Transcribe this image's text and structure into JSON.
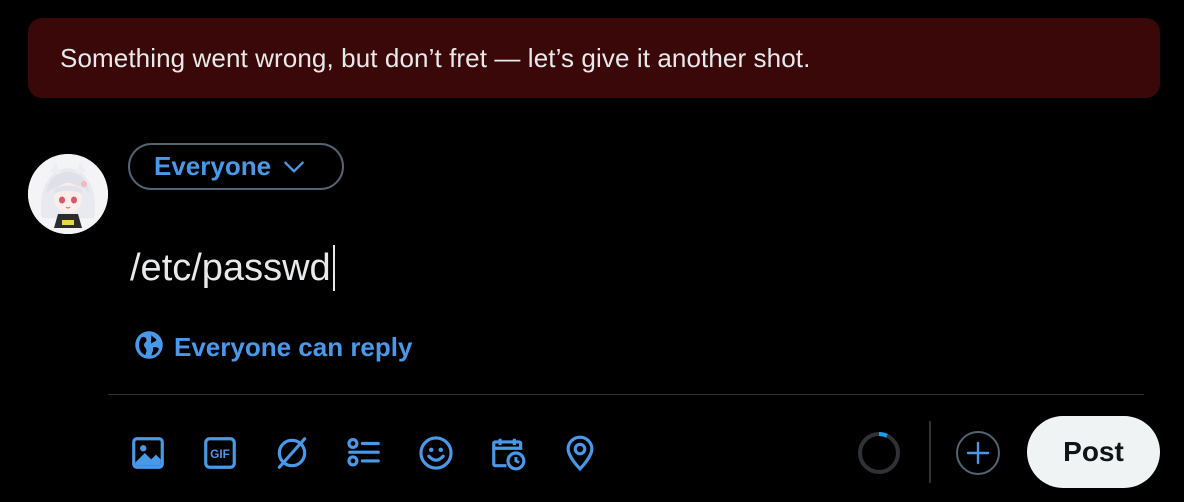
{
  "error_banner": {
    "message": "Something went wrong, but don’t fret — let’s give it another shot."
  },
  "composer": {
    "audience_label": "Everyone",
    "text": "/etc/passwd",
    "reply_setting_label": "Everyone can reply"
  },
  "toolbar": {
    "icons": [
      "media-icon",
      "gif-icon",
      "grok-icon",
      "poll-icon",
      "emoji-icon",
      "schedule-icon",
      "location-icon"
    ],
    "gif_text": "GIF"
  },
  "actions": {
    "post_label": "Post"
  },
  "colors": {
    "accent": "#1d9bf0",
    "accent_text": "#4a99e9",
    "error_bg": "#3b080a",
    "border": "#536471"
  }
}
